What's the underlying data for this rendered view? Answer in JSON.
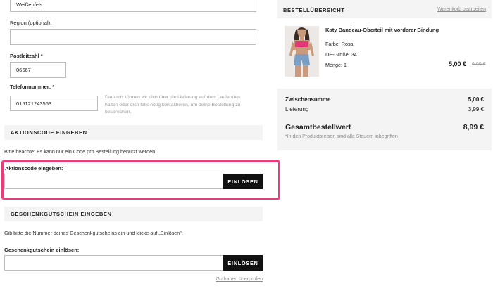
{
  "form": {
    "city_value": "Weißenfels",
    "region_label": "Region (optional):",
    "region_value": "",
    "postcode_label": "Postleitzahl *",
    "postcode_value": "06667",
    "phone_label": "Telefonnummer: *",
    "phone_value": "015121243553",
    "phone_helper": "Dadurch können wir dich über die Lieferung auf dem Laufenden halten oder dich falls nötig kontaktieren, um deine Bestellung zu besprechen."
  },
  "promo": {
    "section_title": "AKTIONSCODE EINGEBEN",
    "note": "Bitte beachte: Es kann nur ein Code pro Bestellung benutzt werden.",
    "field_label": "Aktionscode eingeben:",
    "value": "",
    "button_label": "EINLÖSEN"
  },
  "giftcard": {
    "section_title": "GESCHENKGUTSCHEIN EINGEBEN",
    "note": "Gib bitte die Nummer deines Geschenkgutscheins ein und klicke auf „Einlösen\".",
    "field_label": "Geschenkgutschein einlösen:",
    "value": "",
    "button_label": "EINLÖSEN",
    "check_balance_link": "Guthaben überprüfen"
  },
  "summary": {
    "title": "BESTELLÜBERSICHT",
    "edit_link": "Warenkorb bearbeiten",
    "product": {
      "name": "Katy Bandeau-Oberteil mit vorderer Bindung",
      "color": "Farbe: Rosa",
      "size": "DE-Größe: 34",
      "quantity": "Menge: 1",
      "price": "5,00 €",
      "old_price": "6,00 €"
    },
    "subtotal_label": "Zwischensumme",
    "subtotal_value": "5,00 €",
    "shipping_label": "Lieferung",
    "shipping_value": "3,99 €",
    "total_label": "Gesamtbestellwert",
    "total_value": "8,99 €",
    "tax_note": "*In den Produktpreisen sind alle Steuern inbegriffen"
  },
  "colors": {
    "highlight": "#ea3b7c",
    "button": "#111111",
    "panel": "#f4f4f4"
  }
}
